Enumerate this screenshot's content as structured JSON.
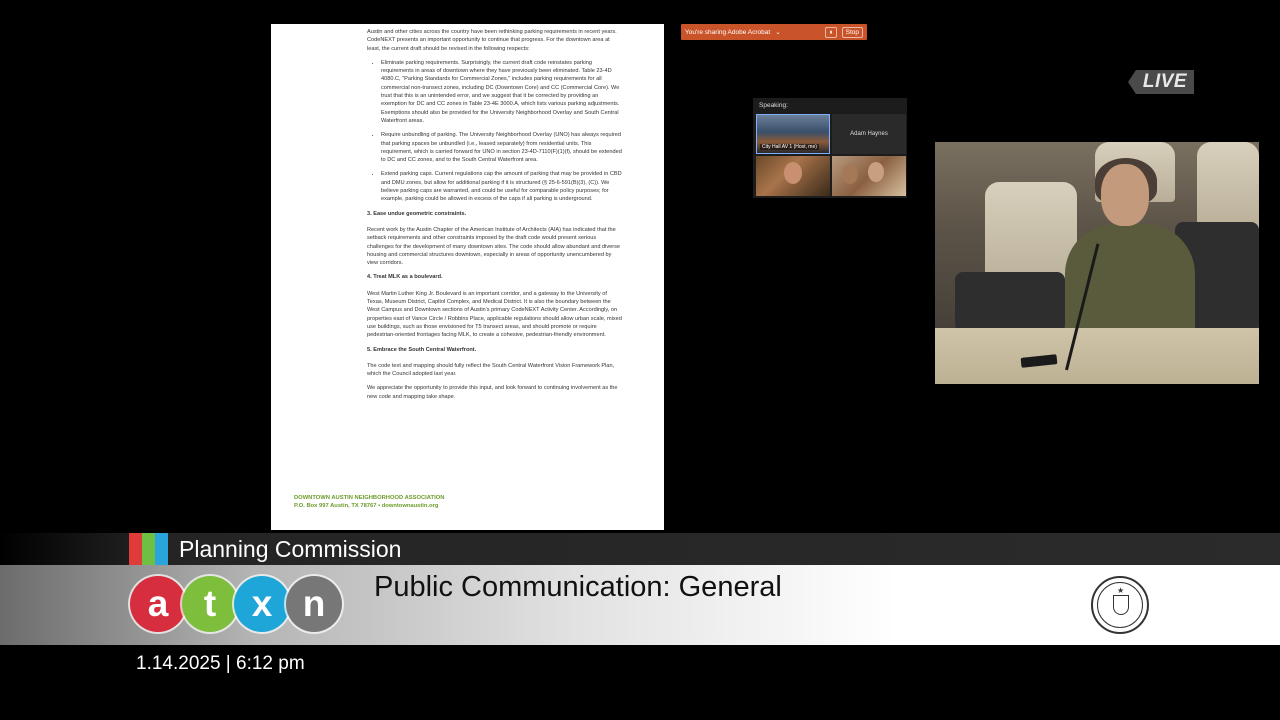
{
  "document": {
    "intro": "Austin and other cities across the country have been rethinking parking requirements in recent years. CodeNEXT presents an important opportunity to continue that progress. For the downtown area at least, the current draft should be revised in the following respects:",
    "bullets": [
      "Eliminate parking requirements. Surprisingly, the current draft code reinstates parking requirements in areas of downtown where they have previously been eliminated. Table 23-4D 4080.C, \"Parking Standards for Commercial Zones,\" includes parking requirements for all commercial non-transect zones, including DC (Downtown Core) and CC (Commercial Core). We trust that this is an unintended error, and we suggest that it be corrected by providing an exemption for DC and CC zones in Table 23-4E 3000.A, which lists various parking adjustments. Exemptions should also be provided for the University Neighborhood Overlay and South Central Waterfront areas.",
      "Require unbundling of parking. The University Neighborhood Overlay (UNO) has always required that parking spaces be unbundled (i.e., leased separately) from residential units. This requirement, which is carried forward for UNO in section 23-4D-7110(F)(1)(f), should be extended to DC and CC zones, and to the South Central Waterfront area.",
      "Extend parking caps. Current regulations cap the amount of parking that may be provided in CBD and DMU zones, but allow for additional parking if it is structured (§ 25-6-591(B)(3), (C)). We believe parking caps are warranted, and could be useful for comparable policy purposes; for example, parking could be allowed in excess of the caps if all parking is underground."
    ],
    "heading3": "3.  Ease undue geometric constraints.",
    "para3": "Recent work by the Austin Chapter of the American Institute of Architects (AIA) has indicated that the setback requirements and other constraints imposed by the draft code would present serious challenges for the development of many downtown sites. The code should allow abundant and diverse housing and commercial structures downtown, especially in areas of opportunity unencumbered by view corridors.",
    "heading4": "4.  Treat MLK as a boulevard.",
    "para4": "West Martin Luther King Jr. Boulevard is an important corridor, and a gateway to the University of Texas, Museum District, Capitol Complex, and Medical District.  It is also the boundary between the West Campus and Downtown sections of Austin's primary CodeNEXT Activity Center.  Accordingly, on properties east of Vance Circle / Robbins Place, applicable regulations should allow urban scale, mixed use buildings, such as those envisioned for T5 transect areas, and should promote or require pedestrian-oriented frontages facing MLK, to create a cohesive, pedestrian-friendly environment.",
    "heading5": "5.  Embrace the South Central Waterfront.",
    "para5": "The code text and mapping should fully reflect the South Central Waterfront Vision Framework Plan, which the Council adopted last year.",
    "closing": "We appreciate the opportunity to provide this input, and look forward to continuing involvement as the new code and mapping take shape.",
    "footer_org": "DOWNTOWN AUSTIN NEIGHBORHOOD ASSOCIATION",
    "footer_addr": "P.O. Box 997 Austin, TX 78767 • downtownaustin.org"
  },
  "share_bar": {
    "text": "You're sharing Adobe Acrobat",
    "pause": "⏸",
    "stop": "Stop",
    "color": "#c9542a"
  },
  "live_badge": {
    "text": "LIVE"
  },
  "speaking_panel": {
    "label": "Speaking:",
    "tiles": [
      {
        "caption": "City Hall AV 1 (Host, me)"
      },
      {
        "caption": "Adam Haynes"
      },
      {
        "caption": ""
      },
      {
        "caption": ""
      }
    ]
  },
  "lower_third": {
    "program": "Planning Commission",
    "headline": "Public Communication: General",
    "datetime": "1.14.2025 | 6:12 pm",
    "logo_letters": [
      "a",
      "t",
      "x",
      "n"
    ],
    "logo_colors": [
      "#d62e3e",
      "#7dbf3c",
      "#1fa6d8",
      "#777777"
    ],
    "bar_colors": [
      "#e03b3b",
      "#6fbf44",
      "#2aa5dc"
    ],
    "seal_label": "City of Austin seal"
  }
}
